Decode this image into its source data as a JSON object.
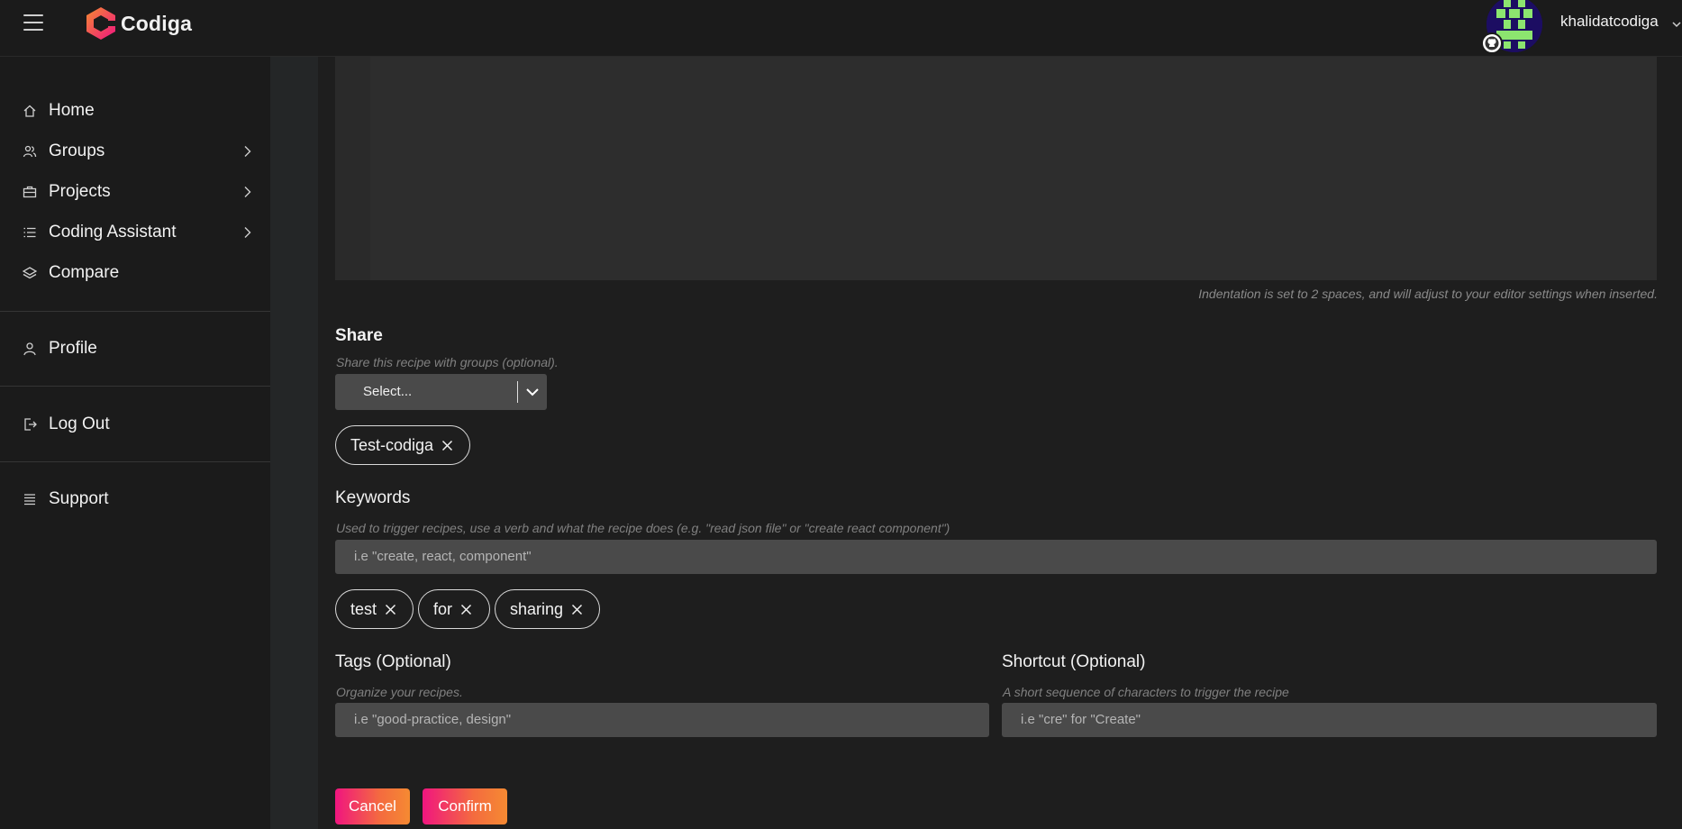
{
  "app": {
    "name": "Codiga"
  },
  "user": {
    "name": "khalidatcodiga"
  },
  "sidebar": {
    "items": [
      {
        "label": "Home"
      },
      {
        "label": "Groups"
      },
      {
        "label": "Projects"
      },
      {
        "label": "Coding Assistant"
      },
      {
        "label": "Compare"
      },
      {
        "label": "Profile"
      },
      {
        "label": "Log Out"
      },
      {
        "label": "Support"
      }
    ]
  },
  "editor": {
    "indentation_note": "Indentation is set to 2 spaces, and will adjust to your editor settings when inserted."
  },
  "share": {
    "title": "Share",
    "hint": "Share this recipe with groups (optional).",
    "select_placeholder": "Select...",
    "selected_groups": [
      "Test-codiga"
    ]
  },
  "keywords": {
    "title": "Keywords",
    "hint": "Used to trigger recipes, use a verb and what the recipe does (e.g. \"read json file\" or \"create react component\")",
    "placeholder": "i.e \"create, react, component\"",
    "values": [
      "test",
      "for",
      "sharing"
    ]
  },
  "tags": {
    "title": "Tags (Optional)",
    "hint": "Organize your recipes.",
    "placeholder": "i.e \"good-practice, design\""
  },
  "shortcut": {
    "title": "Shortcut (Optional)",
    "hint": "A short sequence of characters to trigger the recipe",
    "placeholder": "i.e \"cre\" for \"Create\""
  },
  "actions": {
    "cancel_label": "Cancel",
    "confirm_label": "Confirm"
  },
  "colors": {
    "accent_start": "#f0157f",
    "accent_end": "#f58a32",
    "background": "#1e1e1e",
    "sidebar": "#1b1b1b",
    "input_bg": "#4a4a4a"
  }
}
